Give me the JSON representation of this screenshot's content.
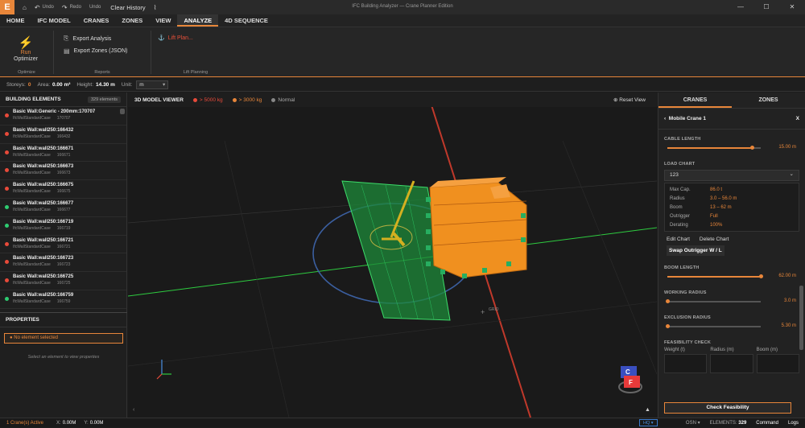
{
  "titlebar": {
    "logo": "E",
    "undo": "Undo",
    "redo": "Redo",
    "undo2": "Undo",
    "clear": "Clear History",
    "title": "IFC Building Analyzer — Crane Planner Edition"
  },
  "menu": [
    "HOME",
    "IFC MODEL",
    "CRANES",
    "ZONES",
    "VIEW",
    "ANALYZE",
    "4D SEQUENCE"
  ],
  "menu_active": "ANALYZE",
  "ribbon": {
    "run_l1": "Run",
    "run_l2": "Optimizer",
    "g1": "Optimize",
    "export_analysis": "Export Analysis",
    "export_zones": "Export Zones (JSON)",
    "g2": "Reports",
    "lift_plan": "Lift Plan...",
    "g3": "Lift Planning"
  },
  "info": {
    "storeys_k": "Storeys:",
    "storeys_v": "0",
    "area_k": "Area:",
    "area_v": "0.00 m²",
    "height_k": "Height:",
    "height_v": "14.30 m",
    "unit_k": "Unit:",
    "unit_v": "m"
  },
  "left": {
    "title": "BUILDING ELEMENTS",
    "count": "329 elements",
    "props_title": "PROPERTIES",
    "no_sel": "No element selected",
    "hint": "Select an element to view properties"
  },
  "elements": [
    {
      "name": "Basic Wall:Generic - 200mm:170707",
      "type": "IfcWallStandardCase",
      "id": "170707",
      "color": "#e84a3a"
    },
    {
      "name": "Basic Wall:wall250:166432",
      "type": "IfcWallStandardCase",
      "id": "166432",
      "color": "#e84a3a"
    },
    {
      "name": "Basic Wall:wall250:166671",
      "type": "IfcWallStandardCase",
      "id": "166671",
      "color": "#e84a3a"
    },
    {
      "name": "Basic Wall:wall250:166673",
      "type": "IfcWallStandardCase",
      "id": "166673",
      "color": "#e84a3a"
    },
    {
      "name": "Basic Wall:wall250:166675",
      "type": "IfcWallStandardCase",
      "id": "166675",
      "color": "#e84a3a"
    },
    {
      "name": "Basic Wall:wall250:166677",
      "type": "IfcWallStandardCase",
      "id": "166677",
      "color": "#2ecc71"
    },
    {
      "name": "Basic Wall:wall250:166719",
      "type": "IfcWallStandardCase",
      "id": "166719",
      "color": "#2ecc71"
    },
    {
      "name": "Basic Wall:wall250:166721",
      "type": "IfcWallStandardCase",
      "id": "166721",
      "color": "#e84a3a"
    },
    {
      "name": "Basic Wall:wall250:166723",
      "type": "IfcWallStandardCase",
      "id": "166723",
      "color": "#e84a3a"
    },
    {
      "name": "Basic Wall:wall250:166725",
      "type": "IfcWallStandardCase",
      "id": "166725",
      "color": "#e84a3a"
    },
    {
      "name": "Basic Wall:wall250:166759",
      "type": "IfcWallStandardCase",
      "id": "166759",
      "color": "#2ecc71"
    }
  ],
  "viewer": {
    "title": "3D MODEL VIEWER",
    "leg1": "> 5000 kg",
    "leg2": "> 3000 kg",
    "leg3": "Normal",
    "reset": "Reset View",
    "grid": "GRID",
    "cube_top": "C",
    "cube_front": "F"
  },
  "right": {
    "tab1": "CRANES",
    "tab2": "ZONES",
    "crane": "Mobile Crane 1",
    "cable_label": "CABLE LENGTH",
    "cable_val": "15.00 m",
    "cable_pct": 0.91,
    "load_label": "LOAD CHART",
    "load_sel": "123",
    "chart": [
      {
        "k": "Max Cap.",
        "v": "86.0 t"
      },
      {
        "k": "Radius",
        "v": "3.0 – 56.0 m"
      },
      {
        "k": "Boom",
        "v": "13 – 62 m"
      },
      {
        "k": "Outrigger",
        "v": "Full"
      },
      {
        "k": "Derating",
        "v": "100%"
      }
    ],
    "edit": "Edit Chart",
    "delete": "Delete Chart",
    "swap": "Swap Outrigger W / L",
    "boom_label": "BOOM LENGTH",
    "boom_val": "62.00 m",
    "boom_pct": 1.0,
    "work_label": "WORKING RADIUS",
    "work_val": "3.0 m",
    "work_pct": 0.0,
    "excl_label": "EXCLUSION RADIUS",
    "excl_val": "5.30 m",
    "excl_pct": 0.0,
    "feas_label": "FEASIBILITY CHECK",
    "f1": "Weight (t)",
    "f2": "Radius (m)",
    "f3": "Boom (m)",
    "check": "Check Feasibility"
  },
  "status": {
    "cranes": "1 Crane(s) Active",
    "x_k": "X:",
    "x": "0.00M",
    "y_k": "Y:",
    "y": "0.00M",
    "hq": "HQ ▾",
    "osn": "OSN ▾",
    "elements_k": "ELEMENTS:",
    "elements": "329",
    "command": "Command",
    "logs": "Logs"
  }
}
